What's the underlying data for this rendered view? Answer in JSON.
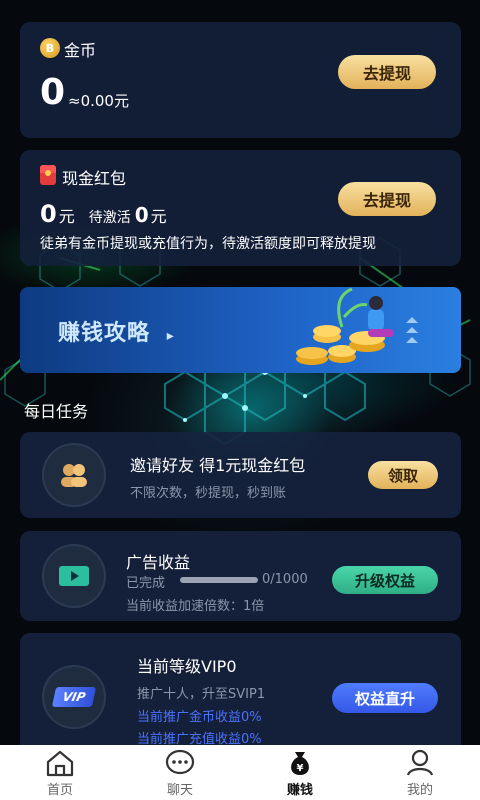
{
  "coins": {
    "title": "金币",
    "icon": "coin-icon",
    "icon_glyph": "B",
    "amount": "0",
    "equivalent": "≈0.00元",
    "withdraw_label": "去提现"
  },
  "cash_red_packet": {
    "title": "现金红包",
    "icon": "red-packet-icon",
    "amount": "0",
    "amount_unit": "元",
    "pending_label": "待激活",
    "pending_amount": "0",
    "pending_unit": "元",
    "withdraw_label": "去提现",
    "note": "徒弟有金币提现或充值行为，待激活额度即可释放提现"
  },
  "banner": {
    "title": "赚钱攻略",
    "arrow": "▸"
  },
  "daily_tasks": {
    "section_title": "每日任务",
    "invite": {
      "title": "邀请好友 得1元现金红包",
      "subtitle": "不限次数，秒提现，秒到账",
      "button": "领取",
      "icon": "friends-icon"
    },
    "ads": {
      "title": "广告收益",
      "completed_label": "已完成",
      "progress_text": "0/1000",
      "progress": 0,
      "multiplier_text": "当前收益加速倍数：1倍",
      "button": "升级权益",
      "icon": "video-play-icon"
    },
    "vip": {
      "title": "当前等级VIP0",
      "subtitle": "推广十人，升至SVIP1",
      "coin_income": "当前推广金币收益0%",
      "recharge_income": "当前推广充值收益0%",
      "button": "权益直升",
      "badge": "VIP",
      "icon": "vip-badge-icon"
    }
  },
  "tabbar": {
    "items": [
      {
        "label": "首页",
        "icon": "home-icon"
      },
      {
        "label": "聊天",
        "icon": "chat-icon"
      },
      {
        "label": "赚钱",
        "icon": "money-bag-icon",
        "active": true
      },
      {
        "label": "我的",
        "icon": "profile-icon"
      }
    ]
  },
  "colors": {
    "card_bg": "#14203c",
    "gold": "#e2b25a",
    "teal": "#2fae86",
    "blue": "#3558e6",
    "link_blue": "#4a72ff"
  }
}
